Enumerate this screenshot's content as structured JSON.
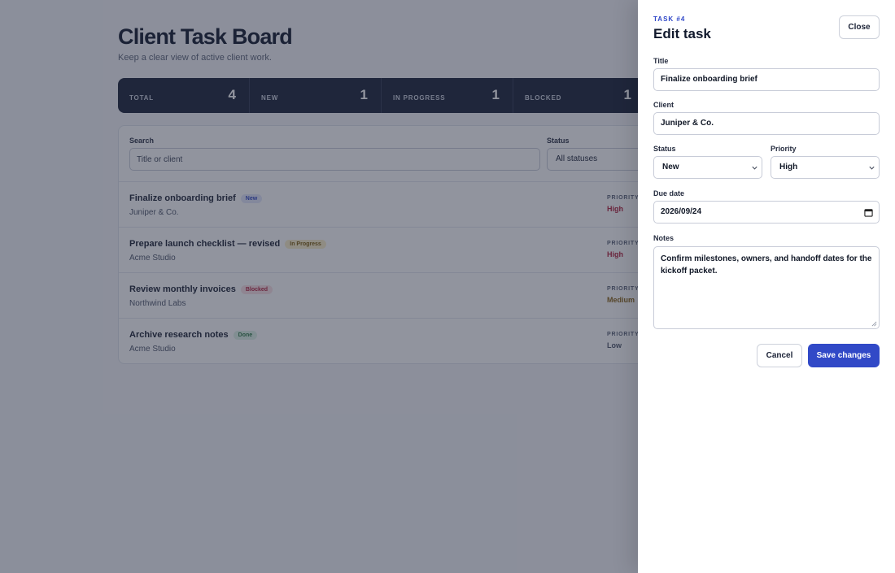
{
  "page": {
    "title": "Client Task Board",
    "subtitle": "Keep a clear view of active client work."
  },
  "stats": [
    {
      "label": "TOTAL",
      "value": "4"
    },
    {
      "label": "NEW",
      "value": "1"
    },
    {
      "label": "IN PROGRESS",
      "value": "1"
    },
    {
      "label": "BLOCKED",
      "value": "1"
    }
  ],
  "filters": {
    "search_label": "Search",
    "search_placeholder": "Title or client",
    "status_label": "Status",
    "status_value": "All statuses"
  },
  "tasks": [
    {
      "title": "Finalize onboarding brief",
      "status": "New",
      "client": "Juniper & Co.",
      "priority_label": "PRIORITY",
      "priority": "High"
    },
    {
      "title": "Prepare launch checklist — revised",
      "status": "In Progress",
      "client": "Acme Studio",
      "priority_label": "PRIORITY",
      "priority": "High"
    },
    {
      "title": "Review monthly invoices",
      "status": "Blocked",
      "client": "Northwind Labs",
      "priority_label": "PRIORITY",
      "priority": "Medium"
    },
    {
      "title": "Archive research notes",
      "status": "Done",
      "client": "Acme Studio",
      "priority_label": "PRIORITY",
      "priority": "Low"
    }
  ],
  "colors": {
    "badge_new": "#e3e7fb",
    "badge_new_text": "#3348c0",
    "badge_in_progress": "#fbefc9",
    "badge_in_progress_text": "#7a5a0b",
    "badge_blocked": "#fbe1e5",
    "badge_blocked_text": "#b2233f",
    "badge_done": "#dff3e6",
    "badge_done_text": "#2f7a47",
    "priority_high": "#b2233f",
    "priority_medium": "#8a6418",
    "priority_low": "#4f576b",
    "accent": "#3149c7"
  },
  "drawer": {
    "eyebrow": "TASK #4",
    "title": "Edit task",
    "close_label": "Close",
    "title_label": "Title",
    "title_value": "Finalize onboarding brief",
    "client_label": "Client",
    "client_value": "Juniper & Co.",
    "status_label": "Status",
    "status_value": "New",
    "priority_label": "Priority",
    "priority_value": "High",
    "due_label": "Due date",
    "due_value": "2026/09/24",
    "notes_label": "Notes",
    "notes_value": "Confirm milestones, owners, and handoff dates for the kickoff packet.",
    "cancel_label": "Cancel",
    "save_label": "Save changes"
  },
  "icons": {
    "select_chevron": "chevron-down-icon",
    "date_picker": "calendar-icon",
    "resize_handle": "resize-handle-icon"
  }
}
